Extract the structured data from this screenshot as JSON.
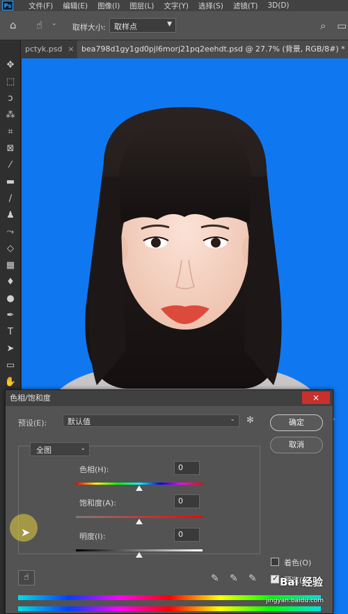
{
  "app": {
    "logo": "Ps",
    "menu": [
      "文件(F)",
      "编辑(E)",
      "图像(I)",
      "图层(L)",
      "文字(Y)",
      "选择(S)",
      "滤镜(T)",
      "3D(D)"
    ]
  },
  "options": {
    "sample_size_label": "取样大小:",
    "sample_size_value": "取样点",
    "icons": [
      "home-icon",
      "hand-tool-icon",
      "search-icon",
      "workspace-icon"
    ]
  },
  "tabs": [
    {
      "label": "pctyk.psd",
      "close": "×"
    },
    {
      "label": "bea798d1gy1gd0pjl6morj21pq2eehdt.psd @ 27.7% (背景, RGB/8#) *",
      "close": ""
    }
  ],
  "dialog": {
    "title": "色相/饱和度",
    "close": "×",
    "preset_label": "预设(E):",
    "preset_value": "默认值",
    "ok": "确定",
    "cancel": "取消",
    "channel": "全图",
    "hue_label": "色相(H):",
    "hue_value": "0",
    "saturation_label": "饱和度(A):",
    "saturation_value": "0",
    "lightness_label": "明度(I):",
    "lightness_value": "0",
    "colorize_label": "着色(O)",
    "colorize_checked": false,
    "preview_label": "预览(P)",
    "preview_checked": true,
    "sliders": {
      "hue": 0.5,
      "saturation": 0.5,
      "lightness": 0.5
    }
  },
  "canvas": {
    "background_color": "#0f78f0"
  },
  "watermark": {
    "brand": "Bai 经验",
    "url": "jingyan.baidu.com"
  }
}
